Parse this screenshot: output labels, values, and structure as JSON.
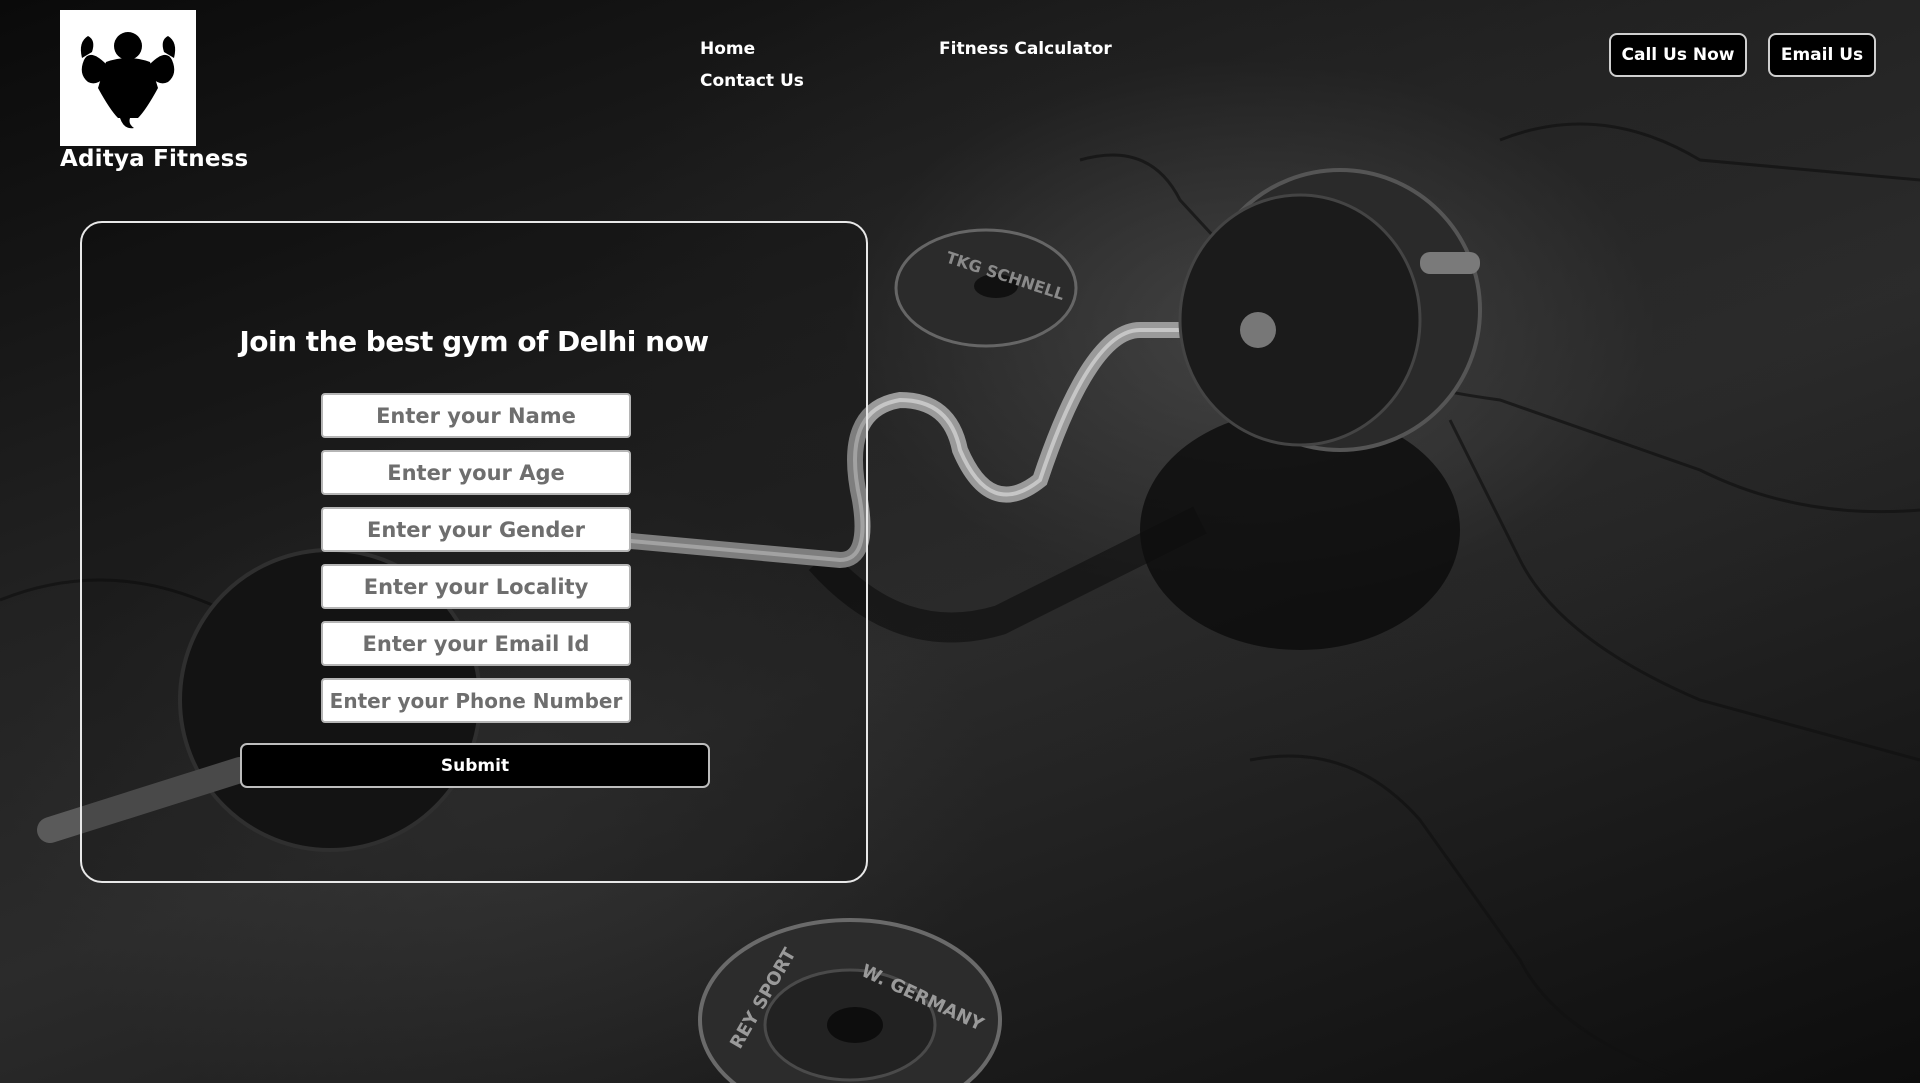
{
  "brand": {
    "name": "Aditya Fitness",
    "logo_icon": "bodybuilder-silhouette-icon"
  },
  "nav": {
    "home": "Home",
    "fitness_calculator": "Fitness Calculator",
    "contact_us": "Contact Us"
  },
  "header_buttons": {
    "call": "Call Us Now",
    "email": "Email Us"
  },
  "form": {
    "heading": "Join the best gym of Delhi now",
    "name_placeholder": "Enter your Name",
    "age_placeholder": "Enter your Age",
    "gender_placeholder": "Enter your Gender",
    "locality_placeholder": "Enter your Locality",
    "email_placeholder": "Enter your Email Id",
    "phone_placeholder": "Enter your Phone Number",
    "submit_label": "Submit"
  },
  "background": {
    "description_icon": "barbell-photo-background",
    "plate_text_1": "TKG SCHNELL",
    "plate_text_2": "W. GERMANY",
    "plate_text_3": "REY SPORT"
  },
  "colors": {
    "text": "#ffffff",
    "button_bg": "#000000",
    "field_bg": "#ffffff"
  }
}
